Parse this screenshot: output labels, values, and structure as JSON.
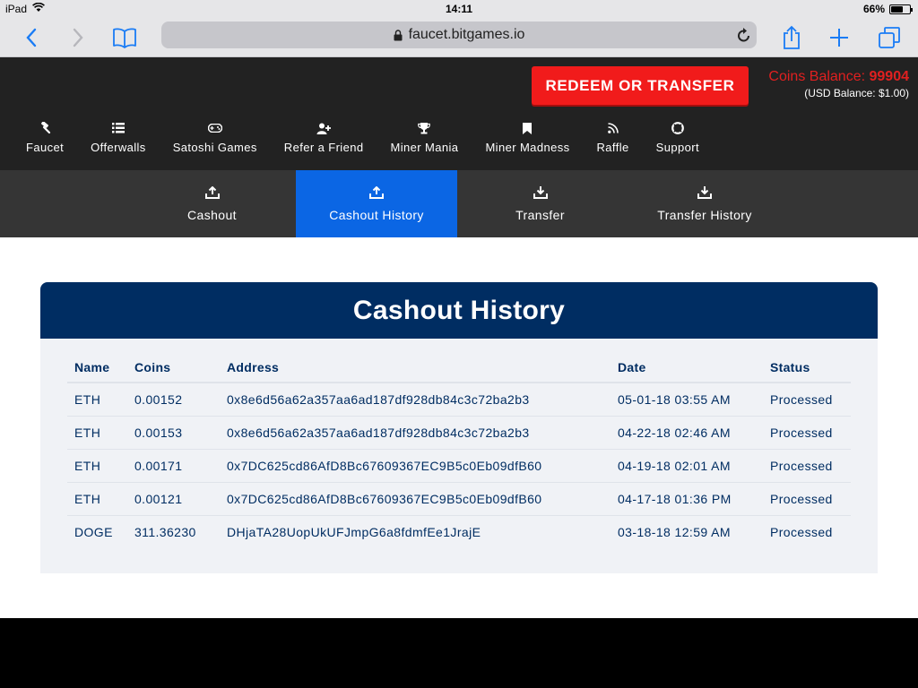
{
  "statusbar": {
    "device": "iPad",
    "time": "14:11",
    "battery": "66%",
    "battery_level": 0.66
  },
  "browser": {
    "url": "faucet.bitgames.io"
  },
  "header": {
    "redeem_label": "REDEEM OR TRANSFER",
    "coins_label": "Coins Balance:",
    "coins_value": "99904",
    "usd_balance": "(USD Balance: $1.00)"
  },
  "nav": {
    "items": [
      {
        "label": "Faucet",
        "icon": "gavel-icon"
      },
      {
        "label": "Offerwalls",
        "icon": "list-icon"
      },
      {
        "label": "Satoshi Games",
        "icon": "gamepad-icon"
      },
      {
        "label": "Refer a Friend",
        "icon": "user-plus-icon"
      },
      {
        "label": "Miner Mania",
        "icon": "trophy-icon"
      },
      {
        "label": "Miner Madness",
        "icon": "bookmark-icon"
      },
      {
        "label": "Raffle",
        "icon": "rss-icon"
      },
      {
        "label": "Support",
        "icon": "life-ring-icon"
      }
    ]
  },
  "subnav": {
    "items": [
      {
        "label": "Cashout",
        "icon": "upload-icon"
      },
      {
        "label": "Cashout History",
        "icon": "upload-icon",
        "active": true
      },
      {
        "label": "Transfer",
        "icon": "download-icon"
      },
      {
        "label": "Transfer History",
        "icon": "download-icon"
      }
    ]
  },
  "colors": {
    "accent": "#0b66e4",
    "brand_red": "#f11b1b",
    "card_header": "#002d62"
  },
  "history": {
    "title": "Cashout History",
    "columns": [
      "Name",
      "Coins",
      "Address",
      "Date",
      "Status"
    ],
    "rows": [
      [
        "ETH",
        "0.00152",
        "0x8e6d56a62a357aa6ad187df928db84c3c72ba2b3",
        "05-01-18 03:55 AM",
        "Processed"
      ],
      [
        "ETH",
        "0.00153",
        "0x8e6d56a62a357aa6ad187df928db84c3c72ba2b3",
        "04-22-18 02:46 AM",
        "Processed"
      ],
      [
        "ETH",
        "0.00171",
        "0x7DC625cd86AfD8Bc67609367EC9B5c0Eb09dfB60",
        "04-19-18 02:01 AM",
        "Processed"
      ],
      [
        "ETH",
        "0.00121",
        "0x7DC625cd86AfD8Bc67609367EC9B5c0Eb09dfB60",
        "04-17-18 01:36 PM",
        "Processed"
      ],
      [
        "DOGE",
        "311.36230",
        "DHjaTA28UopUkUFJmpG6a8fdmfEe1JrajE",
        "03-18-18 12:59 AM",
        "Processed"
      ]
    ]
  }
}
